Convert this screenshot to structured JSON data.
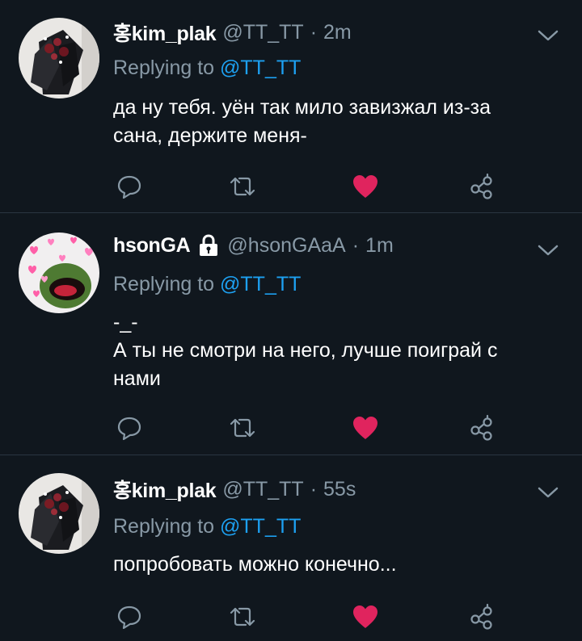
{
  "colors": {
    "background": "#10171e",
    "divider": "#2a3541",
    "secondary_text": "#8899a6",
    "mention": "#1da1f2",
    "like_active": "#e0245e"
  },
  "tweets": [
    {
      "display_name": "홍kim_plak",
      "handle": "@TT_TT",
      "separator": "·",
      "time": "2m",
      "replying_prefix": "Replying to",
      "replying_handle": "@TT_TT",
      "text": "да ну тебя. уён так мило завизжал из-за\nсана, держите меня-",
      "liked": true,
      "protected": false
    },
    {
      "display_name": "hsonGA",
      "handle": "@hsonGAaA",
      "separator": "·",
      "time": "1m",
      "replying_prefix": "Replying to",
      "replying_handle": "@TT_TT",
      "text": "-_-\nА ты не смотри на него, лучше поиграй с\nнами",
      "liked": true,
      "protected": true
    },
    {
      "display_name": "홍kim_plak",
      "handle": "@TT_TT",
      "separator": "·",
      "time": "55s",
      "replying_prefix": "Replying to",
      "replying_handle": "@TT_TT",
      "text": "попробовать можно конечно...",
      "liked": true,
      "protected": false
    }
  ],
  "icons": {
    "reply": "reply-icon",
    "retweet": "retweet-icon",
    "like": "heart-icon",
    "share": "share-icon",
    "more": "chevron-down-icon",
    "lock": "lock-icon"
  }
}
